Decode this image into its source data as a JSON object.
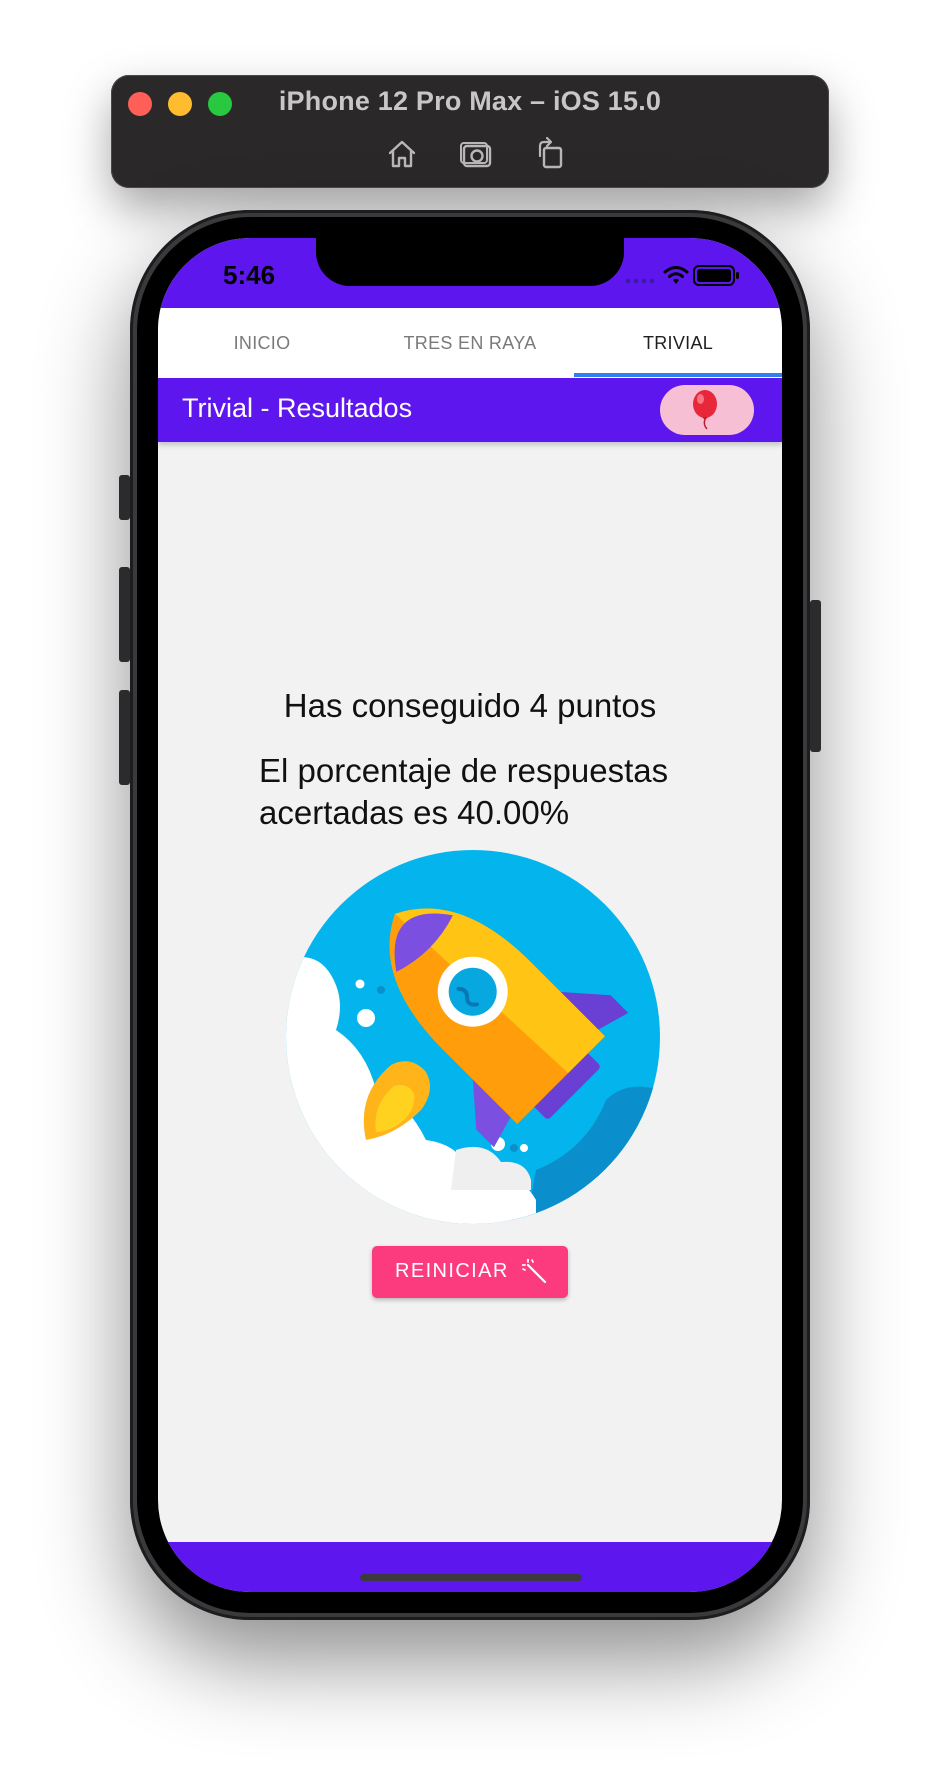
{
  "simulator": {
    "title": "iPhone 12 Pro Max – iOS 15.0",
    "toolbar": [
      "home-icon",
      "screenshot-icon",
      "rotate-icon"
    ]
  },
  "status_bar": {
    "time": "5:46"
  },
  "tabs": [
    {
      "label": "INICIO",
      "active": false
    },
    {
      "label": "TRES EN RAYA",
      "active": false
    },
    {
      "label": "TRIVIAL",
      "active": true
    }
  ],
  "appbar": {
    "title": "Trivial - Resultados",
    "action_icon": "balloon-icon"
  },
  "results": {
    "score_text": "Has conseguido 4 puntos",
    "percentage_text": "El porcentaje de respuestas acertadas es 40.00%",
    "illustration": "rocket-illustration"
  },
  "restart_button": {
    "label": "REINICIAR",
    "icon": "magic-wand-icon"
  },
  "colors": {
    "primary": "#5d17ee",
    "accent_button": "#fb3b7e",
    "tab_indicator": "#2f80ed",
    "balloon_button_bg": "#f6bfd4",
    "screen_bg": "#f2f2f3"
  }
}
